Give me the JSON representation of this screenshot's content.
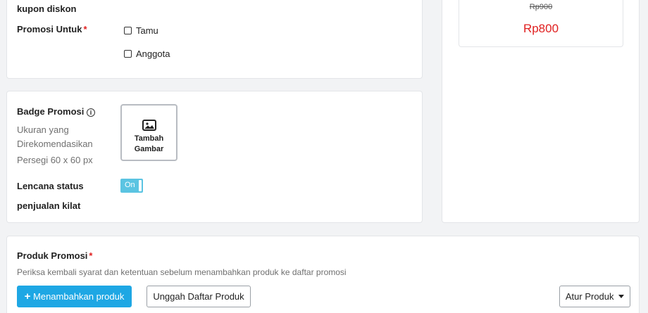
{
  "promo_target_card": {
    "coupon_label": "kupon diskon",
    "promo_for_label": "Promosi Untuk",
    "required_mark": "*",
    "options": [
      {
        "label": "Tamu",
        "checked": false
      },
      {
        "label": "Anggota",
        "checked": false
      }
    ]
  },
  "price_preview": {
    "original_price": "Rp900",
    "sale_price": "Rp800",
    "sale_color": "#e02020"
  },
  "badge_card": {
    "badge_label": "Badge Promosi",
    "info_icon": "info-circle-icon",
    "recommended_size_line1": "Ukuran yang",
    "recommended_size_line2": "Direkomendasikan",
    "recommended_size_line3": "Persegi 60 x 60 px",
    "upload_icon": "image-icon",
    "upload_line1": "Tambah",
    "upload_line2": "Gambar",
    "flash_badge_line1": "Lencana status",
    "flash_badge_line2": "penjualan kilat",
    "toggle_label": "On",
    "toggle_on": true,
    "toggle_color": "#5bc4e2"
  },
  "product_card": {
    "title": "Produk Promosi",
    "required_mark": "*",
    "description": "Periksa kembali syarat dan ketentuan sebelum menambahkan produk ke daftar promosi",
    "add_button_icon": "plus-icon",
    "add_button_label": "Menambahkan produk",
    "upload_list_label": "Unggah Daftar Produk",
    "manage_label": "Atur Produk",
    "manage_icon": "caret-down-icon",
    "accent_color": "#1ea7e4"
  }
}
